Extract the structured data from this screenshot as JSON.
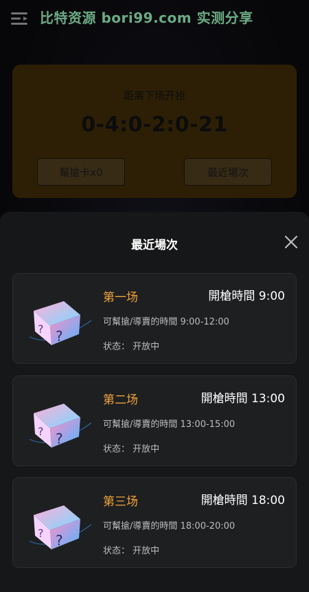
{
  "header": {
    "title": "比特资源 bori99.com 实测分享",
    "menu_icon": "menu-icon"
  },
  "countdown": {
    "label": "距离下场开抢",
    "value": "0-4:0-2:0-21",
    "help_button": "幫搶卡x0",
    "recent_button": "最近場次"
  },
  "sheet": {
    "title": "最近場次",
    "close_icon": "close-icon",
    "sessions": [
      {
        "name": "第一场",
        "start": "開槍時間 9:00",
        "range": "可幫搶/導賣的時間 9:00-12:00",
        "status": "状态： 开放中"
      },
      {
        "name": "第二场",
        "start": "開槍時間 13:00",
        "range": "可幫搶/導賣的時間 13:00-15:00",
        "status": "状态： 开放中"
      },
      {
        "name": "第三场",
        "start": "開槍時間 18:00",
        "range": "可幫搶/導賣的時間 18:00-20:00",
        "status": "状态： 开放中"
      }
    ]
  },
  "colors": {
    "accent_orange": "#f0a33a",
    "title_green": "#8fe3b0",
    "card_bg": "#3d2a08"
  }
}
